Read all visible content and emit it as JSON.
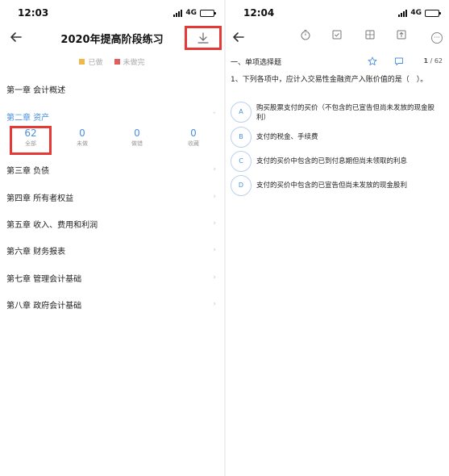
{
  "left": {
    "status_time": "12:03",
    "network": "4G",
    "title": "2020年提高阶段练习",
    "legend": [
      {
        "label": "已做",
        "color": "#f0b74a"
      },
      {
        "label": "未做完",
        "color": "#e35d5d"
      }
    ],
    "chapters": [
      {
        "label": "第一章 会计概述"
      },
      {
        "label": "第二章 资产",
        "active": true
      },
      {
        "label": "第三章 负债"
      },
      {
        "label": "第四章 所有者权益"
      },
      {
        "label": "第五章 收入、费用和利润"
      },
      {
        "label": "第六章 财务报表"
      },
      {
        "label": "第七章 管理会计基础"
      },
      {
        "label": "第八章 政府会计基础"
      }
    ],
    "stats": [
      {
        "num": "62",
        "label": "全部"
      },
      {
        "num": "0",
        "label": "未做"
      },
      {
        "num": "0",
        "label": "做错"
      },
      {
        "num": "0",
        "label": "收藏"
      }
    ],
    "accent": "#4a90e2",
    "highlight": "#e53935"
  },
  "right": {
    "status_time": "12:04",
    "network": "4G",
    "section": "一、单项选择题",
    "counter_current": "1",
    "counter_total": "/ 62",
    "question": "1、下列各项中，应计入交易性金融资产入账价值的是（　）。",
    "options": [
      {
        "letter": "A",
        "text": "购买股票支付的买价（不包含的已宣告但尚未发放的现金股利）"
      },
      {
        "letter": "B",
        "text": "支付的税金、手续费"
      },
      {
        "letter": "C",
        "text": "支付的买价中包含的已到付息期但尚未领取的利息"
      },
      {
        "letter": "D",
        "text": "支付的买价中包含的已宣告但尚未发放的现金股利"
      }
    ]
  }
}
